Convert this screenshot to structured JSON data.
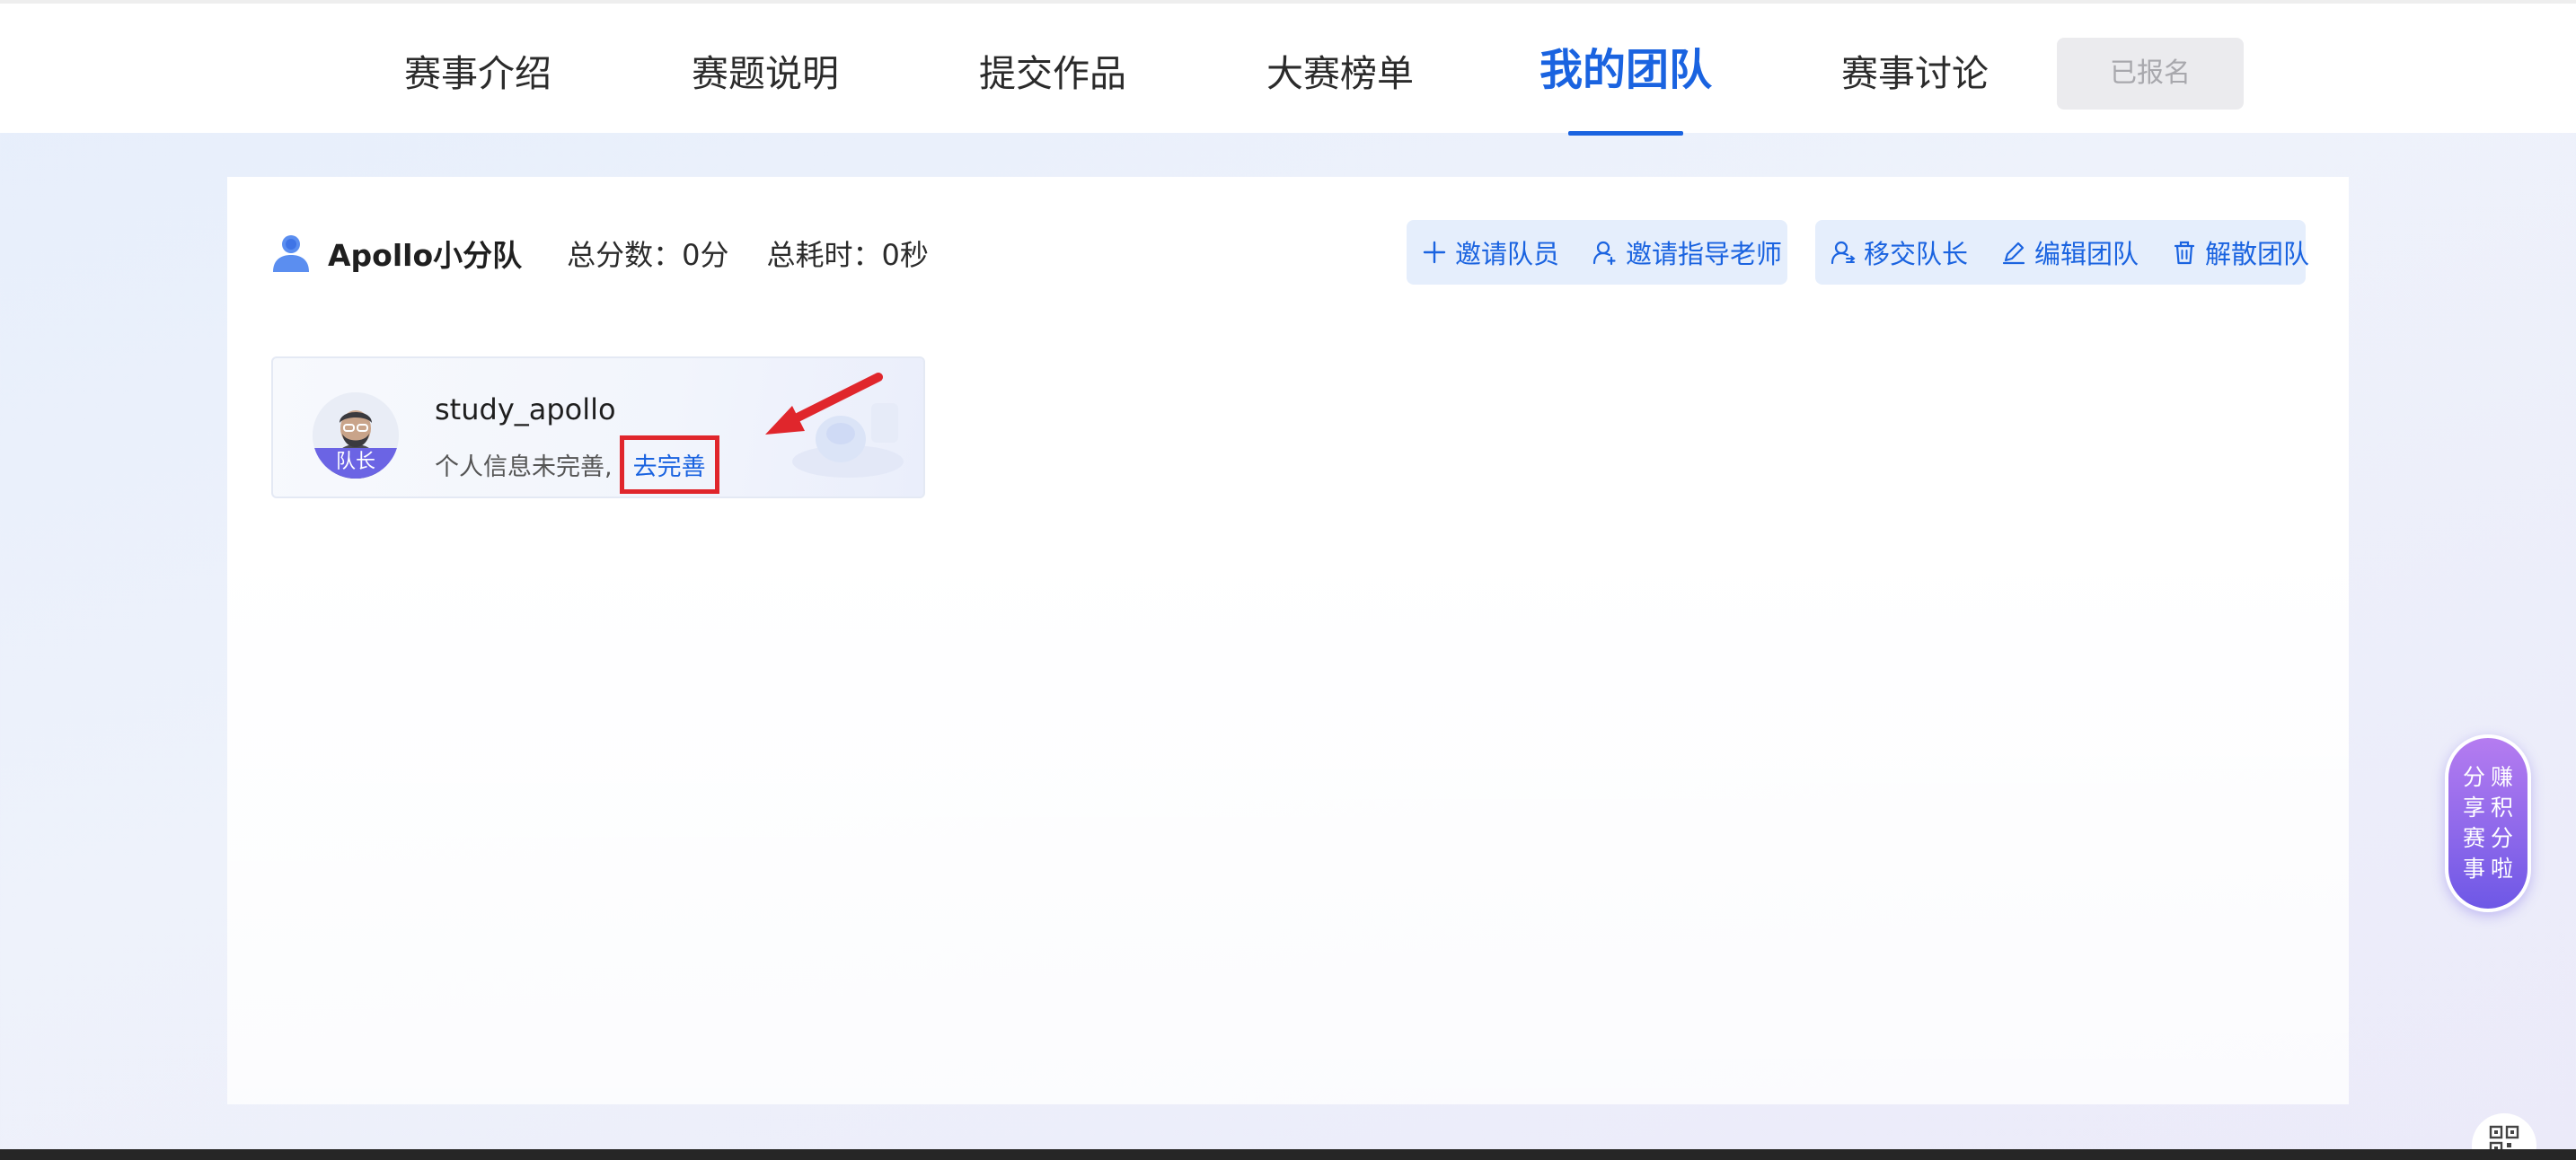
{
  "nav": {
    "tabs": [
      {
        "label": "赛事介绍"
      },
      {
        "label": "赛题说明"
      },
      {
        "label": "提交作品"
      },
      {
        "label": "大赛榜单"
      },
      {
        "label": "我的团队",
        "active": true
      },
      {
        "label": "赛事讨论"
      }
    ],
    "status_button": "已报名"
  },
  "team": {
    "name": "Apollo小分队",
    "total_score": "总分数：0分",
    "total_time": "总耗时：0秒",
    "actions_left": {
      "invite_member": "邀请队员",
      "invite_mentor": "邀请指导老师"
    },
    "actions_right": {
      "transfer_leader": "移交队长",
      "edit_team": "编辑团队",
      "dissolve_team": "解散团队"
    }
  },
  "member": {
    "name": "study_apollo",
    "role_badge": "队长",
    "info_text": "个人信息未完善,",
    "complete_link": "去完善"
  },
  "float_widget": {
    "col_left": [
      "分",
      "享",
      "赛",
      "事"
    ],
    "col_right": [
      "赚",
      "积",
      "分",
      "啦"
    ]
  },
  "colors": {
    "accent": "#1a63e0",
    "highlight_box": "#e0262c",
    "widget_gradient_top": "#b57cf0",
    "widget_gradient_bottom": "#6e58e6"
  },
  "icons": [
    "team-icon",
    "plus-icon",
    "user-add-icon",
    "user-swap-icon",
    "edit-icon",
    "trash-icon",
    "qr-code-icon",
    "red-arrow-icon"
  ]
}
